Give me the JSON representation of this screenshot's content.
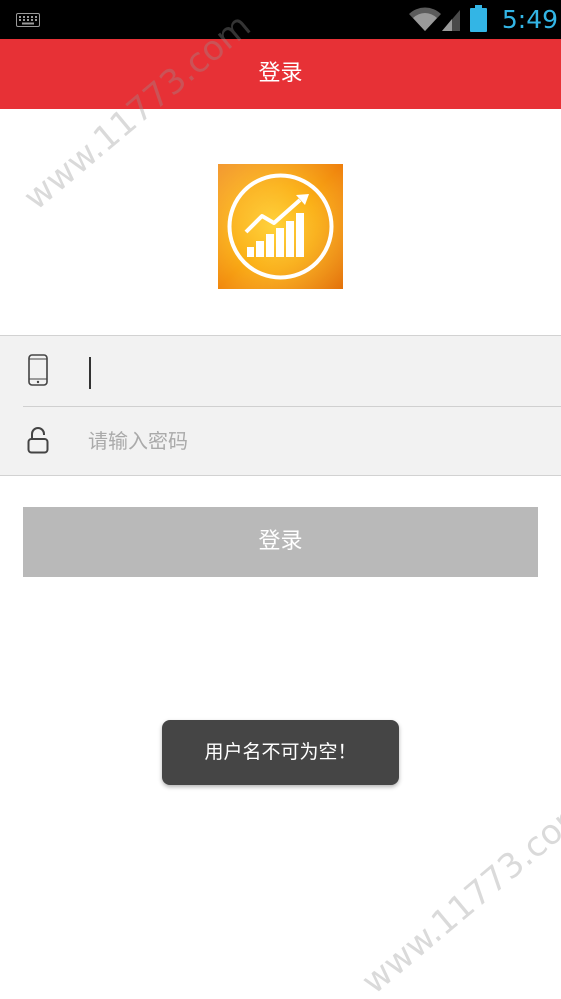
{
  "status_bar": {
    "time": "5:49",
    "icons": [
      "keyboard-icon",
      "wifi-icon",
      "signal-icon",
      "battery-icon"
    ]
  },
  "header": {
    "title": "登录"
  },
  "logo": {
    "icon": "growth-chart-logo"
  },
  "form": {
    "phone_field": {
      "value": "",
      "icon": "phone-icon"
    },
    "password_field": {
      "placeholder": "请输入密码",
      "icon": "lock-icon"
    }
  },
  "login_button": {
    "label": "登录"
  },
  "toast": {
    "message": "用户名不可为空！"
  },
  "watermark": {
    "text": "www.11773.com"
  },
  "colors": {
    "header_bg": "#e73136",
    "button_bg": "#b9b9b9",
    "toast_bg": "#454545",
    "clock": "#33b5e5"
  }
}
